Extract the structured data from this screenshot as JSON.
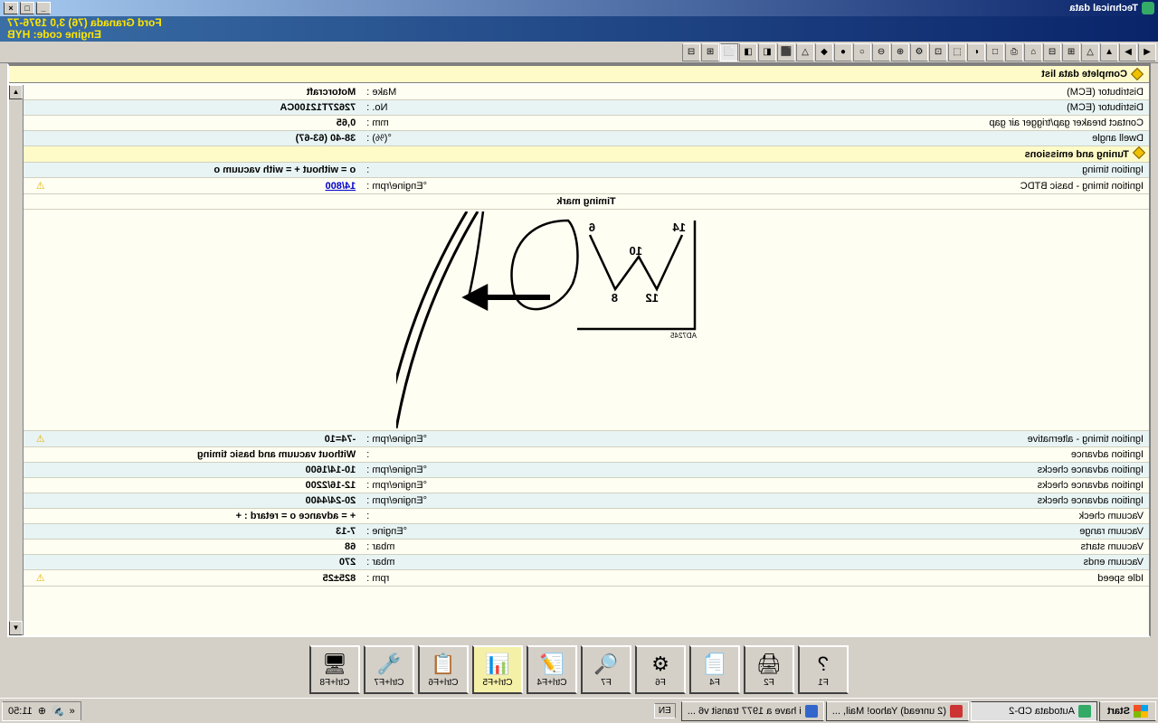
{
  "title": "Technical data",
  "vehicle_line": "Ford   Granada (76) 3,0  1976-77",
  "engine_line": "Engine code: HYB",
  "section_top": "Complete data list",
  "rows1": [
    {
      "label": "Distributor (ECM)",
      "unit": "Make :",
      "val": "Motorcraft",
      "warn": false
    },
    {
      "label": "Distributor (ECM)",
      "unit": "No. :",
      "val": "72627T12100CA",
      "warn": false
    },
    {
      "label": "Contact breaker gap/trigger air gap",
      "unit": "mm :",
      "val": "0,65",
      "warn": false
    },
    {
      "label": "Dwell angle",
      "unit": "°(%) :",
      "val": "38-40 (63-67)",
      "warn": false
    }
  ],
  "section2": "Tuning and emissions",
  "rows2a": [
    {
      "label": "Ignition timing",
      "unit": ":",
      "val": "o = without  + = with vacuum   o",
      "warn": false,
      "link": false
    },
    {
      "label": "Ignition timing - basic  BTDC",
      "unit": "°Engine/rpm :",
      "val": "14/800",
      "warn": true,
      "link": true
    }
  ],
  "diagram_title": "Timing mark",
  "diagram_ref": "AD7245",
  "marks": {
    "a": "14",
    "b": "12",
    "c": "10",
    "d": "8",
    "e": "6"
  },
  "rows2b": [
    {
      "label": "Ignition timing - alternative",
      "unit": "°Engine/rpm :",
      "val": "-74=10",
      "warn": true,
      "link": false
    },
    {
      "label": "Ignition advance",
      "unit": ":",
      "val": "Without vacuum and basic timing",
      "warn": false,
      "link": false
    },
    {
      "label": "Ignition advance checks",
      "unit": "°Engine/rpm :",
      "val": "10-14/1600",
      "warn": false,
      "link": false
    },
    {
      "label": "Ignition advance checks",
      "unit": "°Engine/rpm :",
      "val": "12-16/2200",
      "warn": false,
      "link": false
    },
    {
      "label": "Ignition advance checks",
      "unit": "°Engine/rpm :",
      "val": "20-24/4400",
      "warn": false,
      "link": false
    },
    {
      "label": "Vacuum check",
      "unit": ":",
      "val": "+ = advance  o = retard :   +",
      "warn": false,
      "link": false
    },
    {
      "label": "Vacuum range",
      "unit": "°Engine :",
      "val": "7-13",
      "warn": false,
      "link": false
    },
    {
      "label": "Vacuum starts",
      "unit": "mbar :",
      "val": "68",
      "warn": false,
      "link": false
    },
    {
      "label": "Vacuum ends",
      "unit": "mbar :",
      "val": "270",
      "warn": false,
      "link": false
    },
    {
      "label": "Idle speed",
      "unit": "rpm :",
      "val": "825±25",
      "warn": true,
      "link": false
    }
  ],
  "fkeys": [
    {
      "key": "F1",
      "icon": "?",
      "name": "help"
    },
    {
      "key": "F2",
      "icon": "🖨",
      "name": "print"
    },
    {
      "key": "F4",
      "icon": "📄",
      "name": "page"
    },
    {
      "key": "F6",
      "icon": "⚙",
      "name": "settings"
    },
    {
      "key": "F7",
      "icon": "🔍",
      "name": "find"
    },
    {
      "key": "Ctrl+F4",
      "icon": "📝",
      "name": "edit"
    },
    {
      "key": "Ctrl+F5",
      "icon": "📊",
      "name": "data",
      "active": true
    },
    {
      "key": "Ctrl+F6",
      "icon": "📋",
      "name": "list"
    },
    {
      "key": "Ctrl+F7",
      "icon": "🔧",
      "name": "tool"
    },
    {
      "key": "Ctrl+F8",
      "icon": "🖥",
      "name": "screen"
    }
  ],
  "taskbar": {
    "start": "Start",
    "items": [
      {
        "label": "Autodata CD-2",
        "active": true,
        "color": "#3a6"
      },
      {
        "label": "(2 unread) Yahoo! Mail, ...",
        "active": false,
        "color": "#c33"
      },
      {
        "label": "i have a 1977 transit v6 ...",
        "active": false,
        "color": "#36c"
      }
    ],
    "lang": "EN",
    "clock": "11:50"
  },
  "toolbar_icons": [
    "◀",
    "▶",
    "▲",
    "△",
    "⊞",
    "⊟",
    "⌂",
    "⎙",
    "□",
    "◐",
    "⬚",
    "⊡",
    "⚙",
    "⊕",
    "⊖",
    "○",
    "●",
    "◆",
    "△",
    "⬛",
    "◧",
    "◨",
    "⬜",
    "⊞",
    "⊟"
  ]
}
